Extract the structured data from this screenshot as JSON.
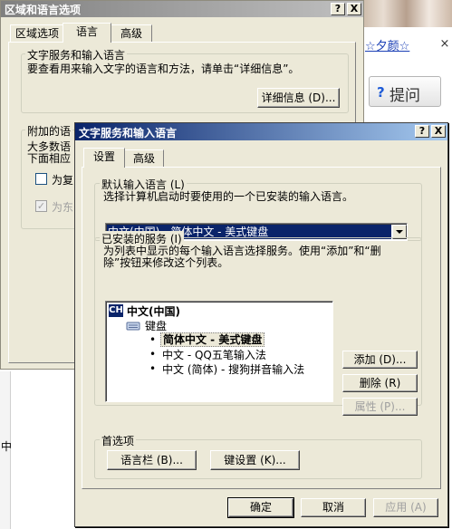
{
  "background": {
    "link_text": "☆夕颜☆",
    "close_glyph": "×",
    "ask_label": "提问",
    "ask_icon": "question-icon",
    "bottom_text": "中"
  },
  "back_dialog": {
    "title": "区域和语言选项",
    "help_glyph": "?",
    "close_glyph": "X",
    "tabs": [
      "区域选项",
      "语言",
      "高级"
    ],
    "active_tab": 1,
    "text_services_group": "文字服务和输入语言",
    "text_services_desc": "要查看用来输入文字的语言和方法，请单击“详细信息”。",
    "details_button": "详细信息 (D)...",
    "additional_group": "附加的语",
    "additional_line1": "大多数语",
    "additional_line2": "下面相应",
    "checkbox1_label": "为复",
    "checkbox2_label": "为东"
  },
  "front_dialog": {
    "title": "文字服务和输入语言",
    "help_glyph": "?",
    "close_glyph": "X",
    "tabs": [
      "设置",
      "高级"
    ],
    "active_tab": 0,
    "default_lang_group": "默认输入语言 (L)",
    "default_lang_desc": "选择计算机启动时要使用的一个已安装的输入语言。",
    "default_lang_value": "中文(中国) - 简体中文 - 美式键盘",
    "installed_group": "已安装的服务 (I)",
    "installed_desc1": "为列表中显示的每个输入语言选择服务。使用“添加”和“删",
    "installed_desc2": "除”按钮来修改这个列表。",
    "tree": {
      "lang_badge": "CH",
      "lang_label": "中文(中国)",
      "keyboard_label": "键盘",
      "items": [
        "简体中文 - 美式键盘",
        "中文 - QQ五笔输入法",
        "中文 (简体) - 搜狗拼音输入法"
      ],
      "selected_index": 0
    },
    "add_button": "添加 (D)...",
    "remove_button": "删除 (R)",
    "properties_button": "属性 (P)...",
    "prefs_group": "首选项",
    "language_bar_button": "语言栏 (B)...",
    "key_settings_button": "键设置 (K)...",
    "ok_button": "确定",
    "cancel_button": "取消",
    "apply_button": "应用 (A)",
    "colors": {
      "titlebar_start": "#0a246a",
      "titlebar_end": "#a6caf0",
      "selection": "#0a246a"
    }
  }
}
